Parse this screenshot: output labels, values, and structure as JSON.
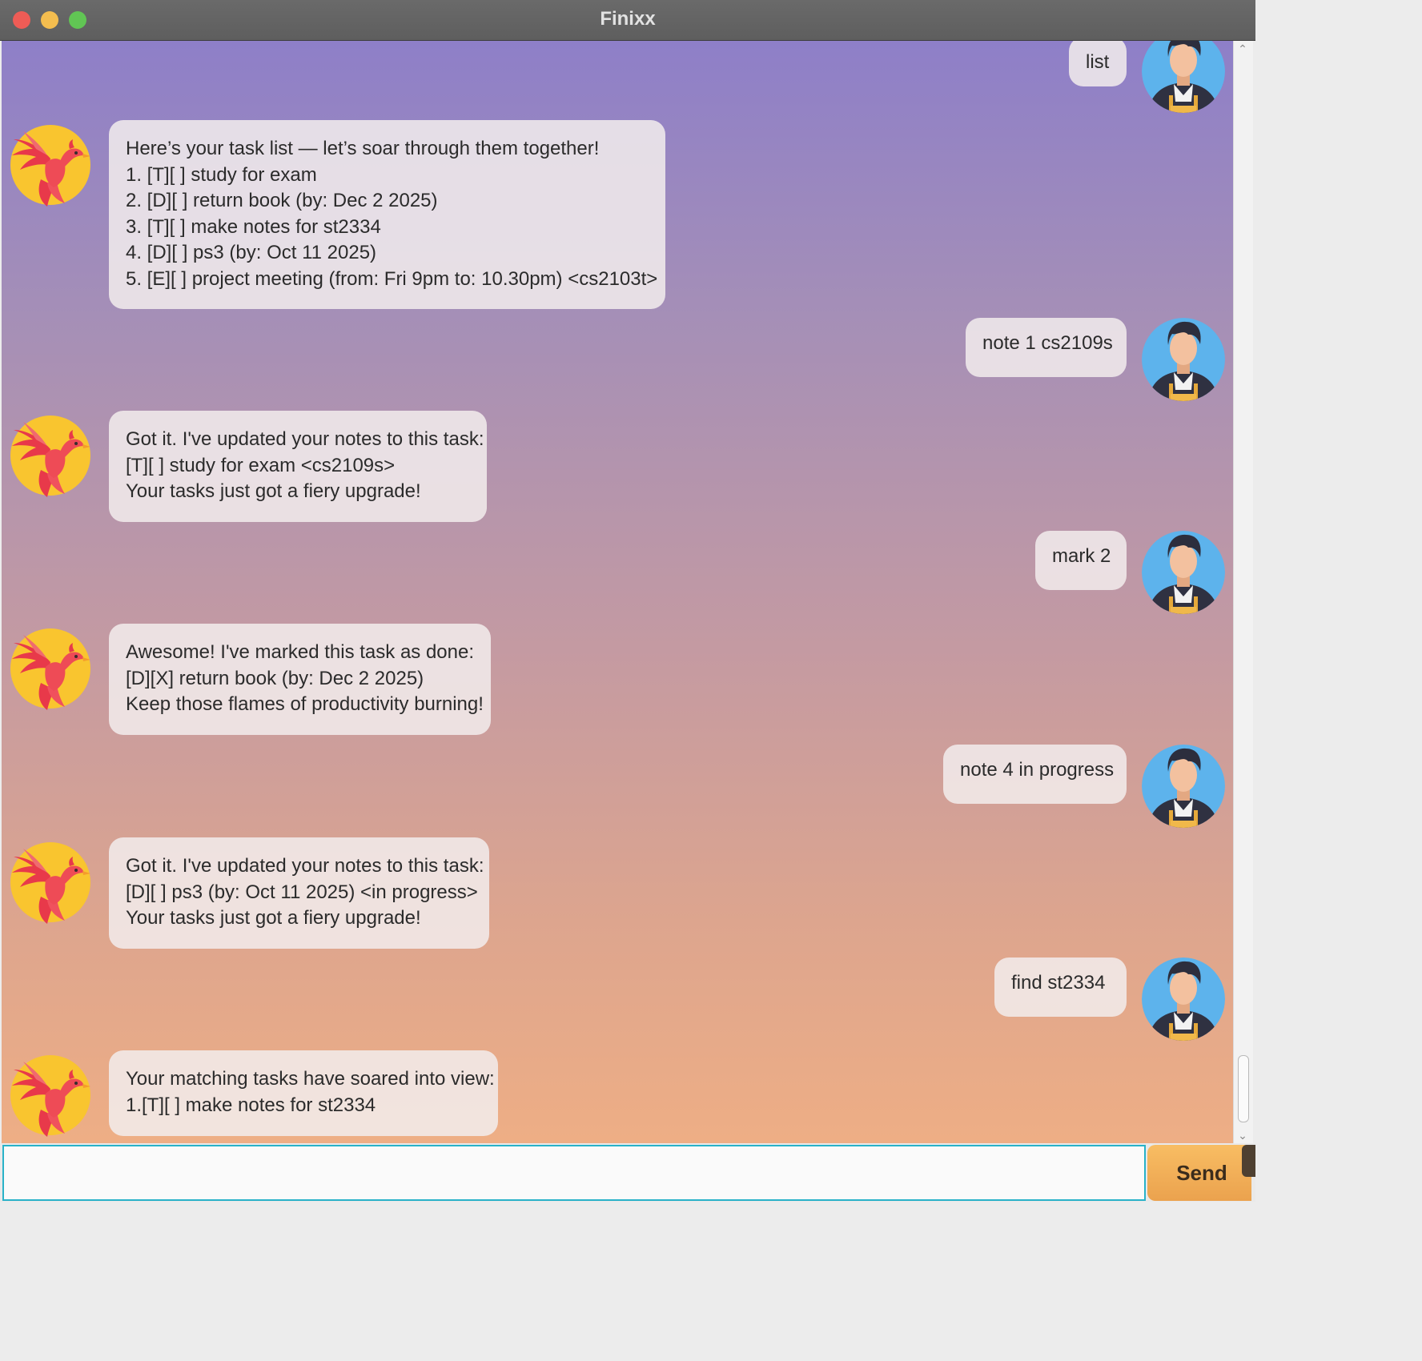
{
  "window": {
    "title": "Finixx"
  },
  "messages": [
    {
      "sender": "user",
      "text": "list"
    },
    {
      "sender": "bot",
      "text": "Here’s your task list — let’s soar through them together!\n1. [T][ ] study for exam\n2. [D][ ] return book (by: Dec 2 2025)\n3. [T][ ] make notes for st2334\n4. [D][ ] ps3 (by: Oct 11 2025)\n5. [E][ ] project meeting (from: Fri 9pm to: 10.30pm) <cs2103t>"
    },
    {
      "sender": "user",
      "text": "note 1 cs2109s"
    },
    {
      "sender": "bot",
      "text": "Got it. I've updated your notes to this task:\n[T][ ] study for exam <cs2109s>\nYour tasks just got a fiery upgrade!"
    },
    {
      "sender": "user",
      "text": "mark 2"
    },
    {
      "sender": "bot",
      "text": "Awesome! I've marked this task as done:\n[D][X] return book (by: Dec 2 2025)\nKeep those flames of productivity burning!"
    },
    {
      "sender": "user",
      "text": "note 4 in progress"
    },
    {
      "sender": "bot",
      "text": "Got it. I've updated your notes to this task:\n[D][ ] ps3 (by: Oct 11 2025) <in progress>\nYour tasks just got a fiery upgrade!"
    },
    {
      "sender": "user",
      "text": "find st2334"
    },
    {
      "sender": "bot",
      "text": "Your matching tasks have soared into view:\n1.[T][ ] make notes for st2334"
    }
  ],
  "input": {
    "value": "",
    "placeholder": ""
  },
  "send_button": {
    "label": "Send"
  },
  "colors": {
    "gradient_top": "#8e7fc8",
    "gradient_bottom": "#eeae85",
    "input_border": "#29b2c8",
    "send_button": "#f2b058"
  }
}
